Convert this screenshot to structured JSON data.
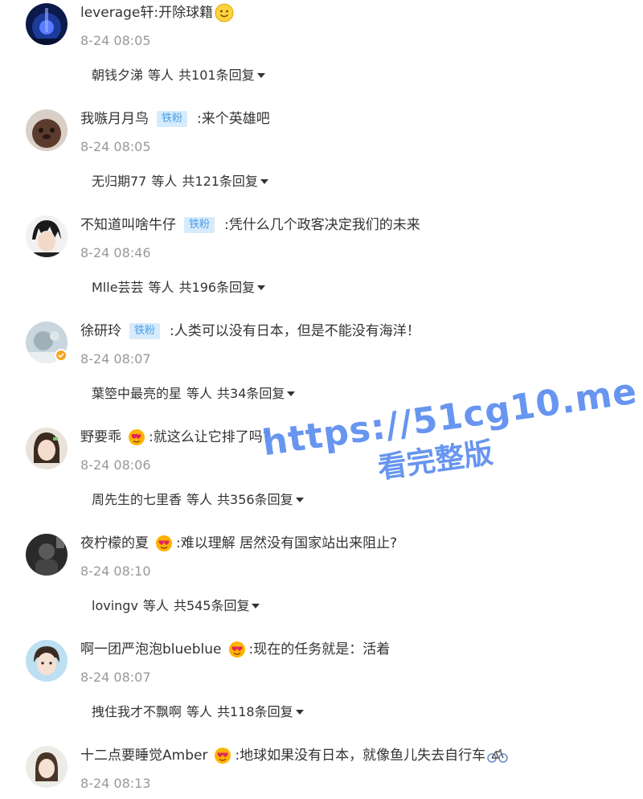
{
  "colors": {
    "fan_badge_bg": "#d6ebfb",
    "fan_badge_text": "#4a9ee8",
    "timestamp": "#999999",
    "watermark": "#5b8def"
  },
  "comments": [
    {
      "username": "leverage轩",
      "badge": null,
      "text": ":开除球籍",
      "emoji": "smiley-emoji",
      "time": "8-24 08:05",
      "reply_user": "朝钱夕涕",
      "reply_mid": "等人",
      "reply_count": "共101条回复"
    },
    {
      "username": "我嗾月月鸟",
      "badge": "铁粉",
      "text": ":来个英雄吧",
      "time": "8-24 08:05",
      "reply_user": "无归期77",
      "reply_mid": "等人",
      "reply_count": "共121条回复"
    },
    {
      "username": "不知道叫啥牛仔",
      "badge": "铁粉",
      "text": ":凭什么几个政客决定我们的未来",
      "time": "8-24 08:46",
      "reply_user": "Mlle芸芸",
      "reply_mid": "等人",
      "reply_count": "共196条回复"
    },
    {
      "username": "徐研玲",
      "badge": "铁粉",
      "text": ":人类可以没有日本，但是不能没有海洋！",
      "time": "8-24 08:07",
      "reply_user": "葉箜中最亮的星",
      "reply_mid": "等人",
      "reply_count": "共34条回复"
    },
    {
      "username": "野要乖",
      "badge_icon": "heart-face-icon",
      "text": ":就这么让它排了吗?",
      "time": "8-24 08:06",
      "reply_user": "周先生的七里香",
      "reply_mid": "等人",
      "reply_count": "共356条回复"
    },
    {
      "username": "夜柠檬的夏",
      "badge_icon": "heart-face-icon",
      "text": ":难以理解 居然没有国家站出来阻止?",
      "time": "8-24 08:10",
      "reply_user": "lovingv",
      "reply_mid": "等人",
      "reply_count": "共545条回复"
    },
    {
      "username": "啊一团严泡泡blueblue",
      "badge_icon": "heart-face-icon",
      "text": ":现在的任务就是：活着",
      "time": "8-24 08:07",
      "reply_user": "拽住我才不飘啊",
      "reply_mid": "等人",
      "reply_count": "共118条回复"
    },
    {
      "username": "十二点要睡觉Amber",
      "badge_icon": "heart-face-icon",
      "text": ":地球如果没有日本，就像鱼儿失去自行车",
      "emoji": "bicycle-emoji",
      "time": "8-24 08:13"
    }
  ],
  "watermark": {
    "url": "https://51cg10.me",
    "subtitle": "看完整版"
  }
}
